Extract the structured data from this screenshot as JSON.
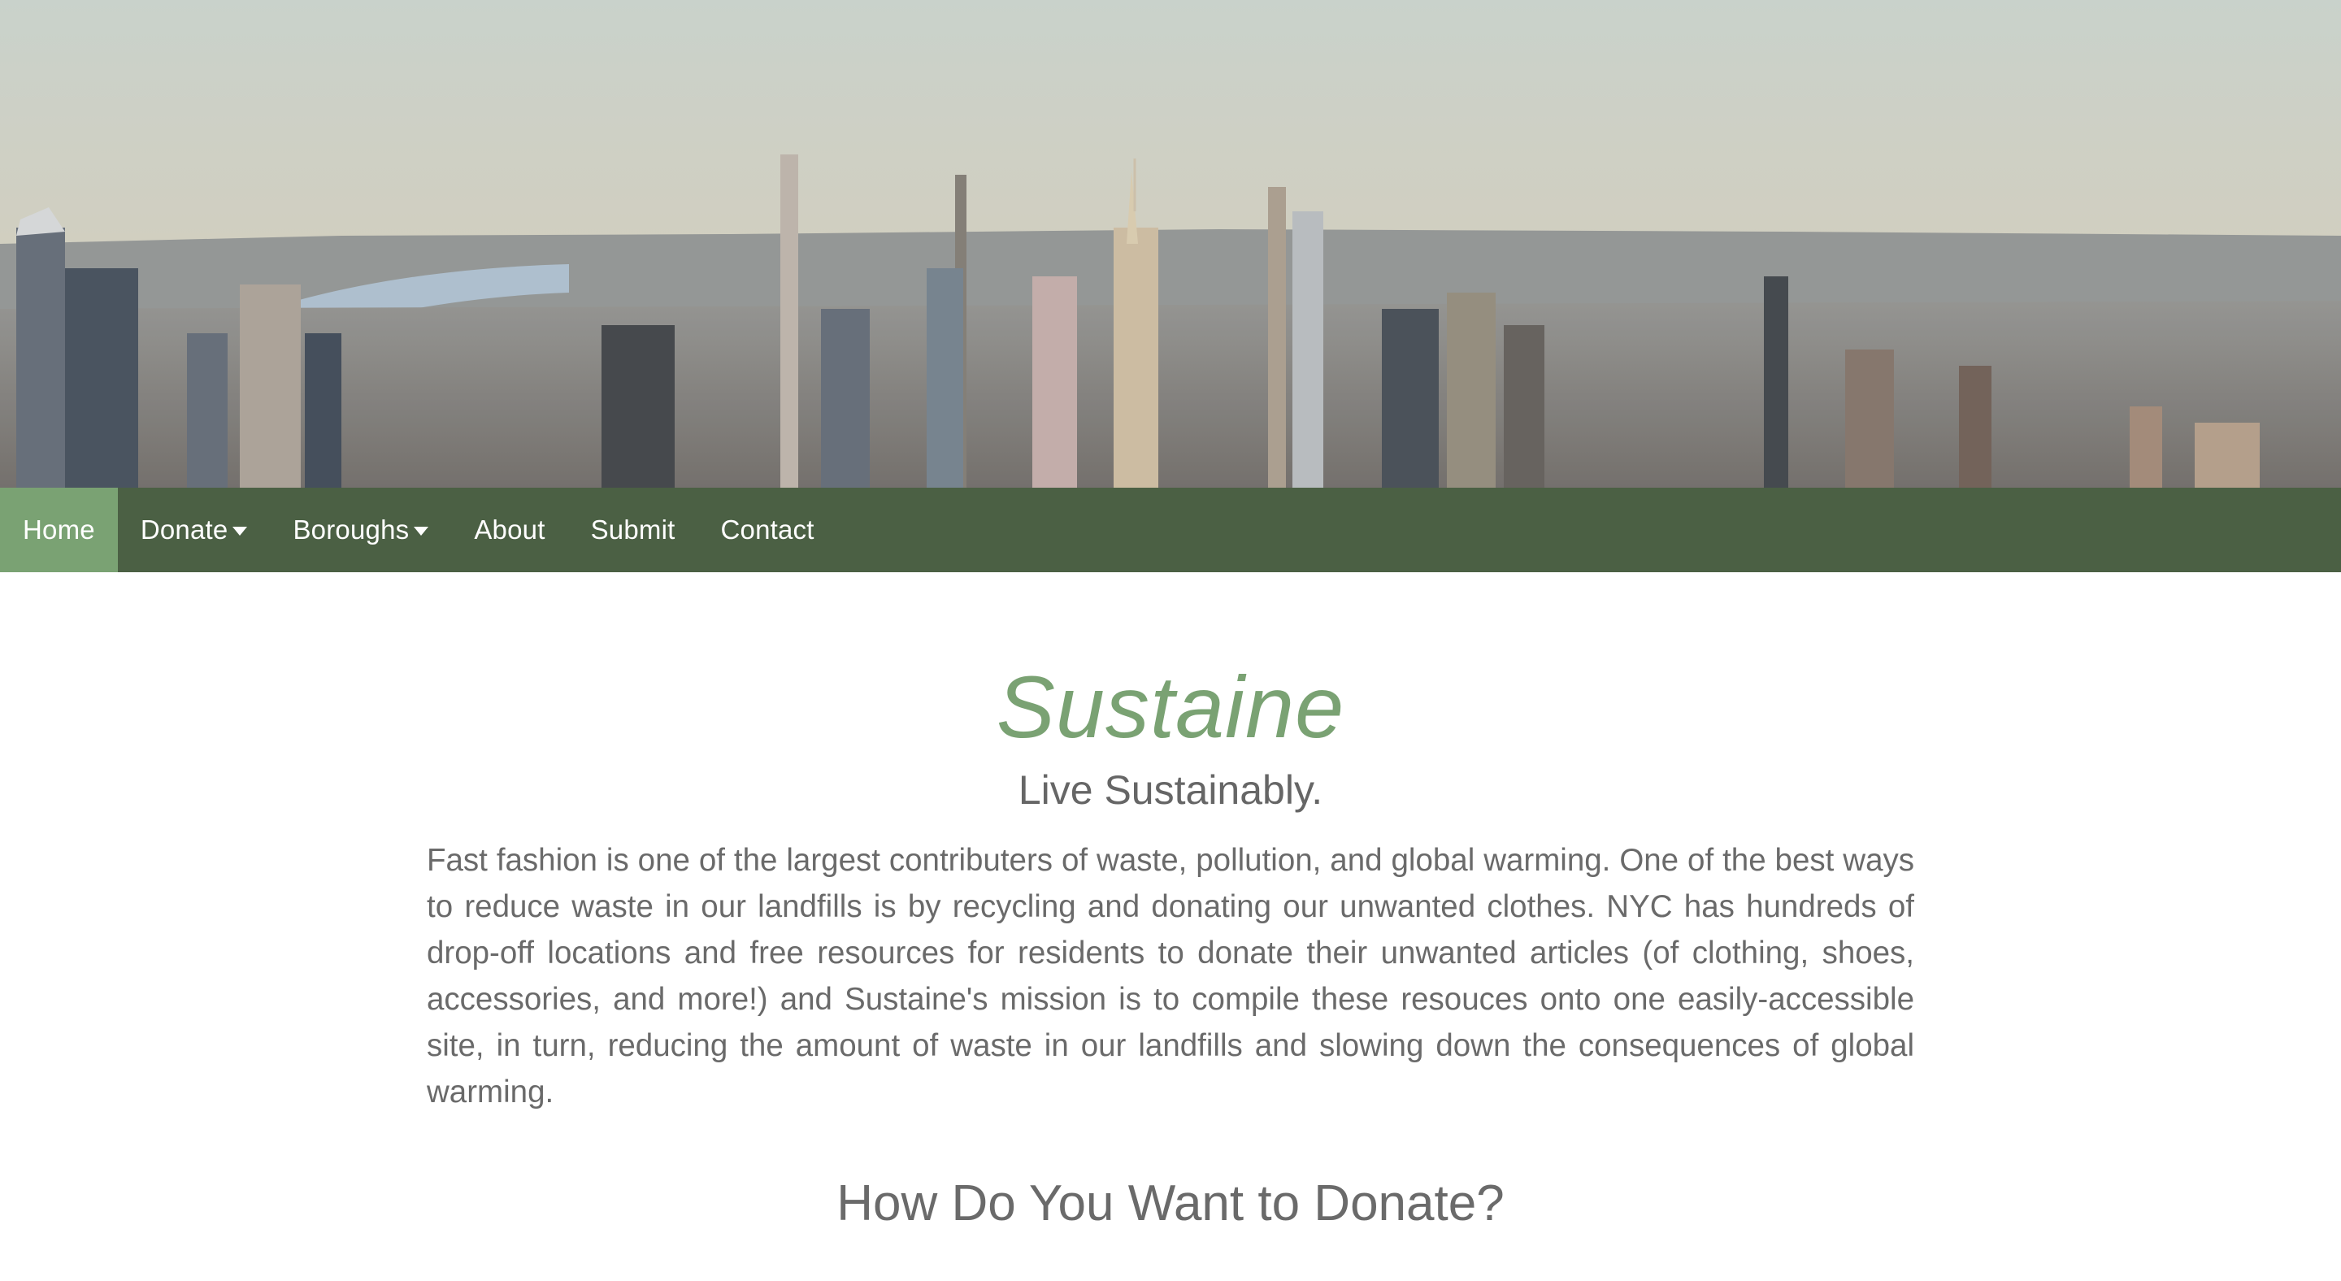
{
  "hero": {
    "alt": "New York City skyline"
  },
  "nav": {
    "items": [
      {
        "label": "Home",
        "active": true,
        "dropdown": false
      },
      {
        "label": "Donate",
        "active": false,
        "dropdown": true
      },
      {
        "label": "Boroughs",
        "active": false,
        "dropdown": true
      },
      {
        "label": "About",
        "active": false,
        "dropdown": false
      },
      {
        "label": "Submit",
        "active": false,
        "dropdown": false
      },
      {
        "label": "Contact",
        "active": false,
        "dropdown": false
      }
    ]
  },
  "main": {
    "brand": "Sustaine",
    "tagline": "Live Sustainably.",
    "mission": "Fast fashion is one of the largest contributers of waste, pollution, and global warming. One of the best ways to reduce waste in our landfills is by recycling and donating our unwanted clothes. NYC has hundreds of drop-off locations and free resources for residents to donate their unwanted articles (of clothing, shoes, accessories, and more!) and Sustaine's mission is to compile these resouces onto one easily-accessible site, in turn, reducing the amount of waste in our landfills and slowing down the consequences of global warming.",
    "section_title": "How Do You Want to Donate?"
  },
  "colors": {
    "nav_bg": "#4b6044",
    "nav_active": "#7aa273",
    "brand": "#7aa273",
    "text": "#6a6a6a"
  }
}
